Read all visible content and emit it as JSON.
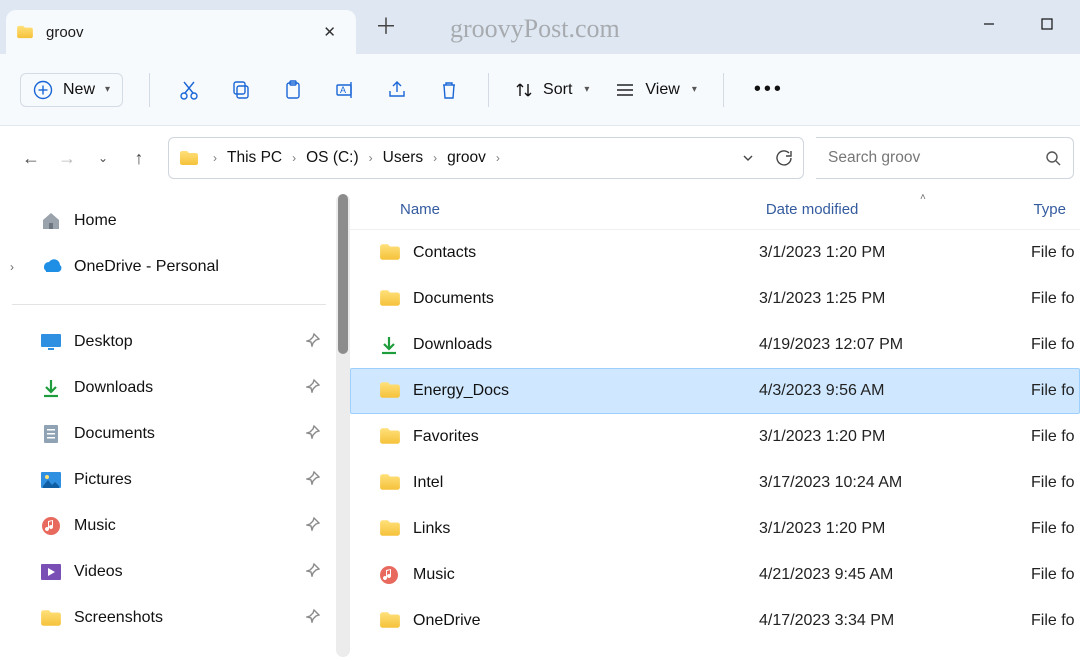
{
  "tab": {
    "title": "groov"
  },
  "watermark": "groovyPost.com",
  "toolbar": {
    "new_label": "New",
    "sort_label": "Sort",
    "view_label": "View"
  },
  "breadcrumbs": [
    "This PC",
    "OS (C:)",
    "Users",
    "groov"
  ],
  "search": {
    "placeholder": "Search groov"
  },
  "sidebar_top": [
    {
      "label": "Home",
      "icon": "home"
    },
    {
      "label": "OneDrive - Personal",
      "icon": "onedrive",
      "expandable": true
    }
  ],
  "sidebar_pinned": [
    {
      "label": "Desktop",
      "icon": "desktop"
    },
    {
      "label": "Downloads",
      "icon": "downloads"
    },
    {
      "label": "Documents",
      "icon": "documents"
    },
    {
      "label": "Pictures",
      "icon": "pictures"
    },
    {
      "label": "Music",
      "icon": "music"
    },
    {
      "label": "Videos",
      "icon": "videos"
    },
    {
      "label": "Screenshots",
      "icon": "folder"
    }
  ],
  "headers": {
    "name": "Name",
    "date": "Date modified",
    "type": "Type"
  },
  "files": [
    {
      "name": "Contacts",
      "date": "3/1/2023 1:20 PM",
      "type": "File fo",
      "icon": "folder"
    },
    {
      "name": "Documents",
      "date": "3/1/2023 1:25 PM",
      "type": "File fo",
      "icon": "folder"
    },
    {
      "name": "Downloads",
      "date": "4/19/2023 12:07 PM",
      "type": "File fo",
      "icon": "downloads"
    },
    {
      "name": "Energy_Docs",
      "date": "4/3/2023 9:56 AM",
      "type": "File fo",
      "icon": "folder",
      "selected": true
    },
    {
      "name": "Favorites",
      "date": "3/1/2023 1:20 PM",
      "type": "File fo",
      "icon": "folder"
    },
    {
      "name": "Intel",
      "date": "3/17/2023 10:24 AM",
      "type": "File fo",
      "icon": "folder"
    },
    {
      "name": "Links",
      "date": "3/1/2023 1:20 PM",
      "type": "File fo",
      "icon": "folder"
    },
    {
      "name": "Music",
      "date": "4/21/2023 9:45 AM",
      "type": "File fo",
      "icon": "music"
    },
    {
      "name": "OneDrive",
      "date": "4/17/2023 3:34 PM",
      "type": "File fo",
      "icon": "folder"
    }
  ]
}
